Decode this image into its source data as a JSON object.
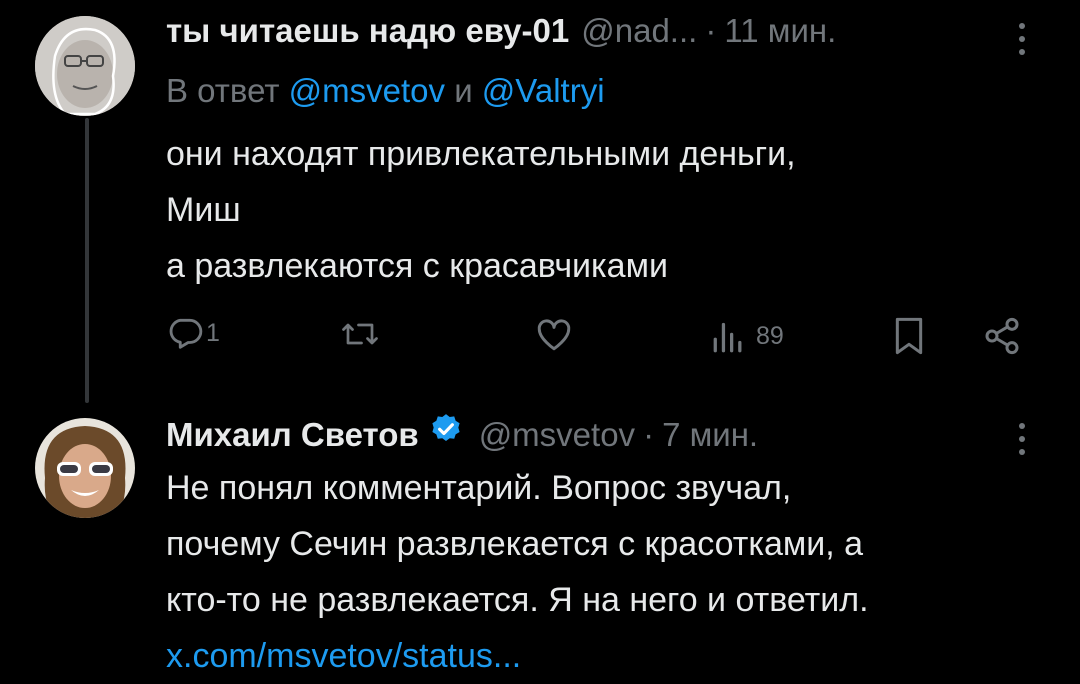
{
  "tweets": [
    {
      "author_name": "ты читаешь надю еву-01",
      "handle": "@nad...",
      "separator": "·",
      "time": "11 мин.",
      "reply_prefix": "В ответ",
      "reply_mention_1": "@msvetov",
      "reply_conj": "и",
      "reply_mention_2": "@Valtryi",
      "text_lines": [
        "они находят привлекательными деньги,",
        "Миш",
        "а развлекаются с красавчиками"
      ],
      "reply_count": "1",
      "views_count": "89"
    },
    {
      "author_name": "Михаил Светов",
      "handle": "@msvetov",
      "separator": "·",
      "time": "7 мин.",
      "text_lines": [
        "Не понял комментарий. Вопрос звучал,",
        "почему Сечин развлекается с красотками, а",
        "кто-то не развлекается. Я на него и ответил."
      ],
      "link_text": "x.com/msvetov/status..."
    }
  ],
  "colors": {
    "background": "#000000",
    "text": "#e7e9ea",
    "secondary": "#71767b",
    "accent": "#1d9bf0"
  },
  "icons": [
    "reply-icon",
    "retweet-icon",
    "like-icon",
    "views-icon",
    "bookmark-icon",
    "share-icon",
    "more-icon",
    "verified-badge-icon"
  ]
}
